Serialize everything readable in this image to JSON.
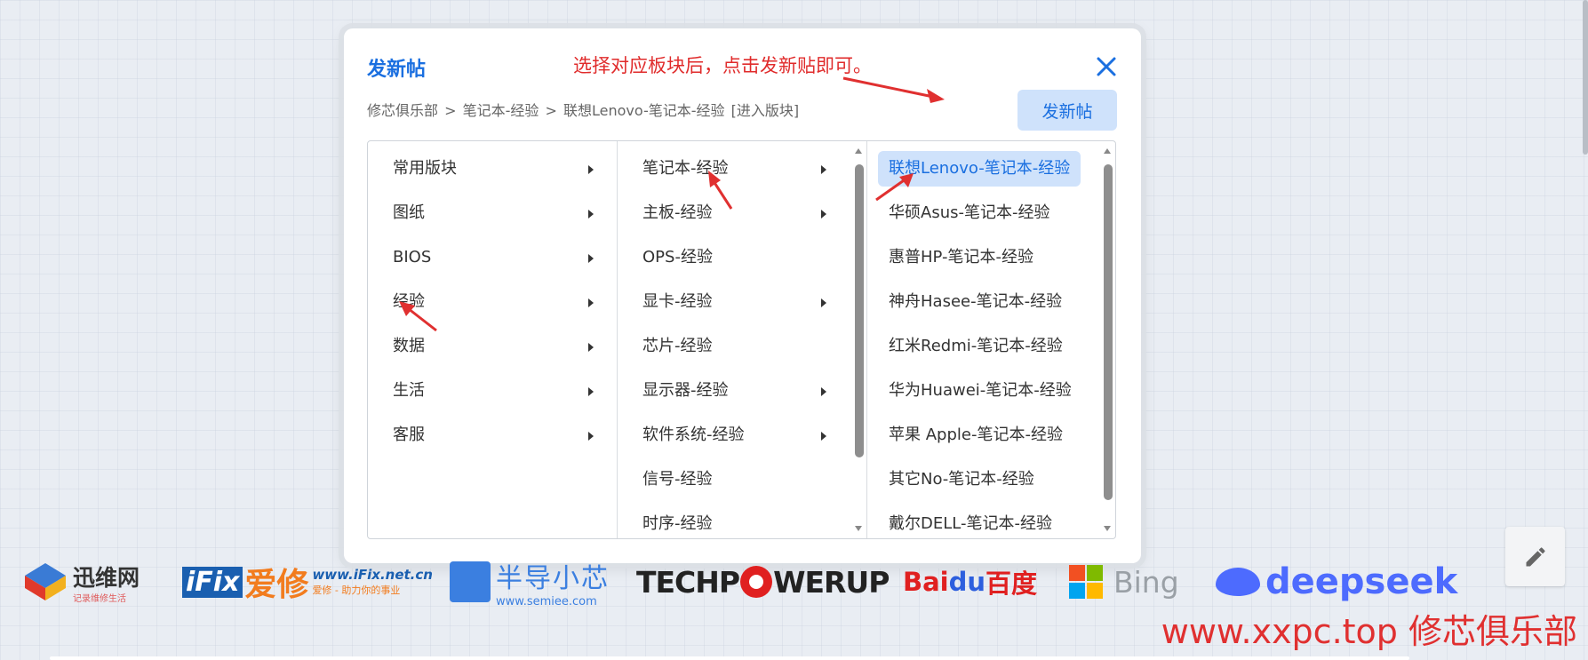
{
  "modal": {
    "title": "发新帖",
    "tip": "选择对应板块后，点击发新贴即可。",
    "breadcrumb": [
      "修芯俱乐部",
      ">",
      "笔记本-经验",
      ">",
      "联想Lenovo-笔记本-经验",
      "[进入版块]"
    ],
    "post_button_label": "发新帖",
    "columns": [
      {
        "items": [
          {
            "label": "常用版块",
            "has_children": true
          },
          {
            "label": "图纸",
            "has_children": true
          },
          {
            "label": "BIOS",
            "has_children": true
          },
          {
            "label": "经验",
            "has_children": true
          },
          {
            "label": "数据",
            "has_children": true
          },
          {
            "label": "生活",
            "has_children": true
          },
          {
            "label": "客服",
            "has_children": true
          }
        ]
      },
      {
        "items": [
          {
            "label": "笔记本-经验",
            "has_children": true
          },
          {
            "label": "主板-经验",
            "has_children": true
          },
          {
            "label": "OPS-经验",
            "has_children": false
          },
          {
            "label": "显卡-经验",
            "has_children": true
          },
          {
            "label": "芯片-经验",
            "has_children": false
          },
          {
            "label": "显示器-经验",
            "has_children": true
          },
          {
            "label": "软件系统-经验",
            "has_children": true
          },
          {
            "label": "信号-经验",
            "has_children": false
          },
          {
            "label": "时序-经验",
            "has_children": false
          }
        ]
      },
      {
        "items": [
          {
            "label": "联想Lenovo-笔记本-经验",
            "selected": true
          },
          {
            "label": "华硕Asus-笔记本-经验"
          },
          {
            "label": "惠普HP-笔记本-经验"
          },
          {
            "label": "神舟Hasee-笔记本-经验"
          },
          {
            "label": "红米Redmi-笔记本-经验"
          },
          {
            "label": "华为Huawei-笔记本-经验"
          },
          {
            "label": "苹果 Apple-笔记本-经验"
          },
          {
            "label": "其它No-笔记本-经验"
          },
          {
            "label": "戴尔DELL-笔记本-经验"
          }
        ]
      }
    ]
  },
  "logos": {
    "xunwei": {
      "name": "迅维网",
      "slogan": "记录维修生活"
    },
    "ifix": {
      "box": "iFix",
      "cn": "爱修",
      "url": "www.iFix.net.cn",
      "slogan": "爱修 - 助力你的事业"
    },
    "semiee": {
      "name": "半导小芯",
      "url": "www.semiee.com"
    },
    "techpowerup": {
      "left": "TECHP",
      "right": "WERUP"
    },
    "baidu": {
      "bai": "Bai",
      "du": "du",
      "cn": "百度"
    },
    "bing": {
      "name": "Bing"
    },
    "deepseek": {
      "name": "deepseek"
    }
  },
  "watermark": "www.xxpc.top 修芯俱乐部",
  "colors": {
    "accent": "#1a6fe0",
    "tip_red": "#e02b2b",
    "selected_bg": "#cfe2fb"
  },
  "icons": {
    "close": "close-icon",
    "submenu": "chevron-right-icon",
    "edit": "pencil-icon"
  }
}
